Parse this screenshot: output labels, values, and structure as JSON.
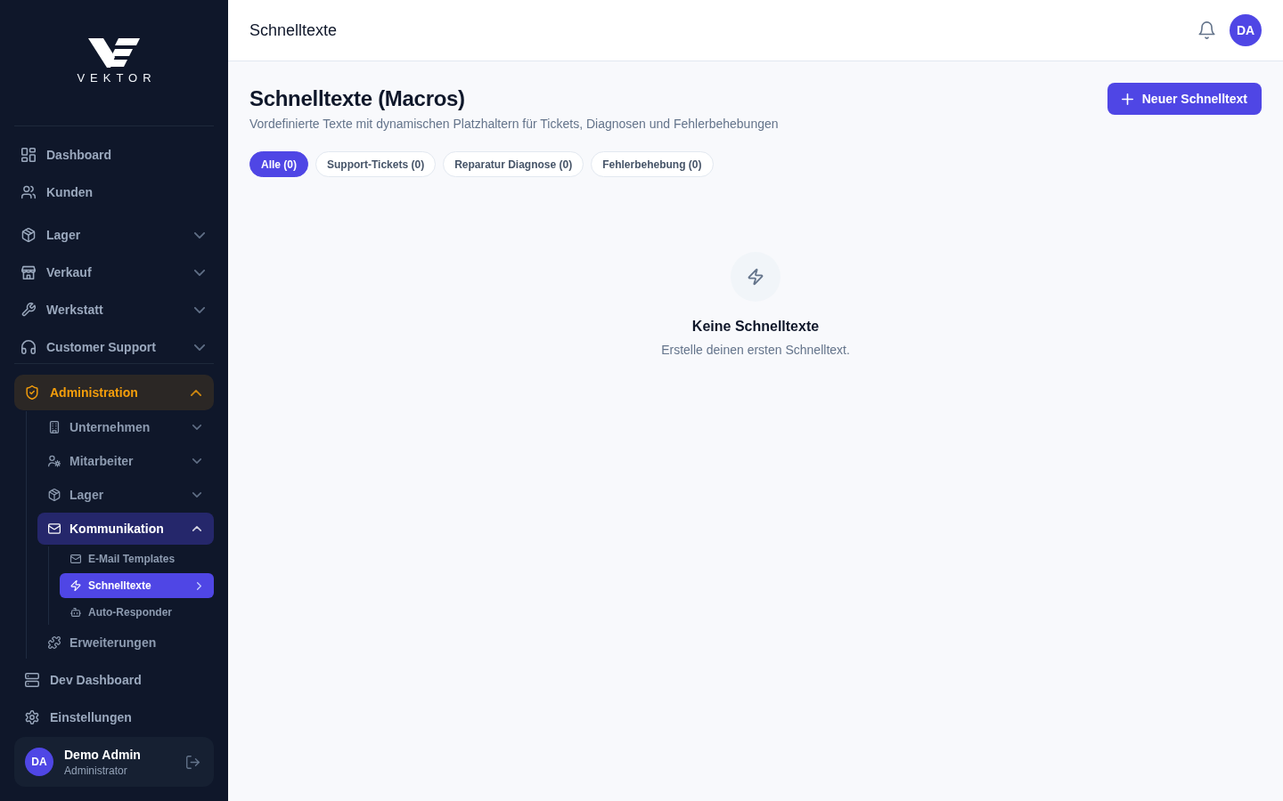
{
  "sidebar": {
    "logo": {
      "wordmark": "VEKTOR"
    },
    "nav_sections": [
      {
        "items": [
          {
            "label": "Dashboard",
            "selected": false
          },
          {
            "label": "Kunden",
            "selected": false
          }
        ]
      },
      {
        "items": [
          {
            "label": "Lager",
            "selected": false,
            "expanded": false
          },
          {
            "label": "Verkauf",
            "selected": false,
            "expanded": false
          },
          {
            "label": "Werkstatt",
            "selected": false,
            "expanded": false
          },
          {
            "label": "Customer Support",
            "selected": false,
            "expanded": false
          }
        ]
      }
    ],
    "admin_nav": [
      {
        "label": "Administration",
        "selected": false,
        "expanded": true,
        "children": [
          {
            "label": "Unternehmen",
            "selected": false,
            "expanded": false
          },
          {
            "label": "Mitarbeiter",
            "selected": false,
            "expanded": false
          },
          {
            "label": "Lager",
            "selected": false,
            "expanded": false
          },
          {
            "label": "Kommunikation",
            "selected": false,
            "expanded": true,
            "children": [
              {
                "label": "E-Mail Templates",
                "selected": false
              },
              {
                "label": "Schnelltexte",
                "selected": true
              },
              {
                "label": "Auto-Responder",
                "selected": false
              }
            ]
          },
          {
            "label": "Erweiterungen",
            "selected": false
          }
        ]
      },
      {
        "label": "Dev Dashboard",
        "selected": false
      },
      {
        "label": "Einstellungen",
        "selected": false
      }
    ],
    "user": {
      "initials": "DA",
      "name": "Demo Admin",
      "role": "Administrator"
    }
  },
  "header": {
    "title": "Schnelltexte",
    "avatar_initials": "DA"
  },
  "page": {
    "title": "Schnelltexte (Macros)",
    "subtitle": "Vordefinierte Texte mit dynamischen Platzhaltern für Tickets, Diagnosen und Fehlerbehebungen",
    "new_button": {
      "label": "Neuer Schnelltext"
    },
    "filters": [
      {
        "label": "Alle (0)",
        "selected": true
      },
      {
        "label": "Support-Tickets (0)",
        "selected": false
      },
      {
        "label": "Reparatur Diagnose (0)",
        "selected": false
      },
      {
        "label": "Fehlerbehebung (0)",
        "selected": false
      }
    ],
    "empty_state": {
      "title": "Keine Schnelltexte",
      "message": "Erstelle deinen ersten Schnelltext."
    }
  }
}
